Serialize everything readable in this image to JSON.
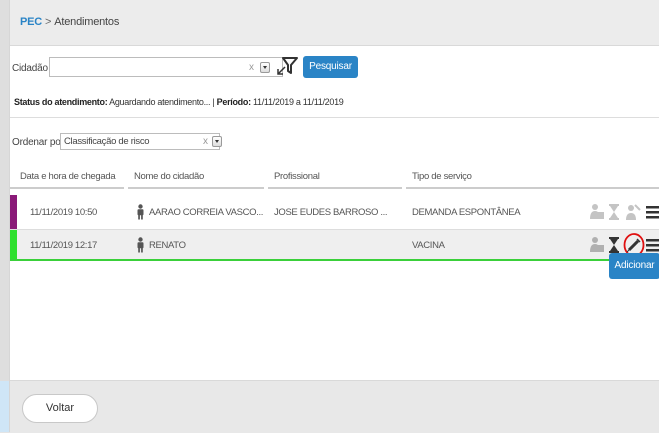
{
  "breadcrumb": {
    "root": "PEC",
    "separator": ">",
    "current": "Atendimentos"
  },
  "filters": {
    "cidadao_label": "Cidadão",
    "cidadao_value": "",
    "clear_symbol": "x",
    "search_label": "Pesquisar"
  },
  "status_line": {
    "status_label": "Status do atendimento:",
    "status_value": "Aguardando atendimento...",
    "divider": "|",
    "periodo_label": "Período:",
    "periodo_value": "11/11/2019 a 11/11/2019"
  },
  "sort": {
    "label": "Ordenar por",
    "value": "Classificação de risco",
    "clear_symbol": "x"
  },
  "table": {
    "headers": [
      "Data e hora de chegada",
      "Nome do cidadão",
      "Profissional",
      "Tipo de serviço"
    ],
    "rows": [
      {
        "datetime": "11/11/2019 10:50",
        "name": "AARAO CORREIA VASCO...",
        "professional": "JOSE EUDES BARROSO ...",
        "service": "DEMANDA ESPONTÂNEA",
        "risk_color": "#8a1a78"
      },
      {
        "datetime": "11/11/2019 12:17",
        "name": "RENATO",
        "professional": "",
        "service": "VACINA",
        "risk_color": "#2ee02e"
      }
    ]
  },
  "actions": {
    "add_label": "Adicionar",
    "back_label": "Voltar"
  },
  "colors": {
    "accent": "#2a84c6",
    "highlight_circle": "#e01010",
    "selected_row_border": "#3ad03a"
  }
}
